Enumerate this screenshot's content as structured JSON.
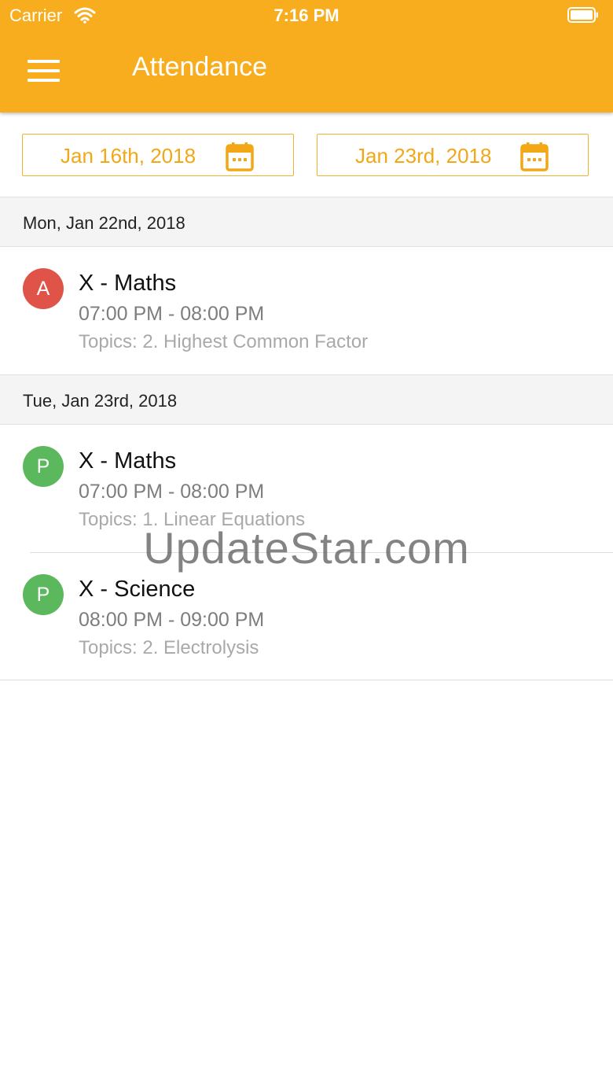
{
  "status_bar": {
    "carrier": "Carrier",
    "time": "7:16 PM"
  },
  "app_bar": {
    "title": "Attendance",
    "menu_icon": "hamburger-menu-icon"
  },
  "date_range": {
    "from": "Jan 16th, 2018",
    "to": "Jan 23rd, 2018",
    "icon": "calendar-icon"
  },
  "sections": [
    {
      "header": "Mon, Jan 22nd, 2018",
      "items": [
        {
          "badge": "A",
          "subject": "X - Maths",
          "time": "07:00 PM - 08:00 PM",
          "topics": "Topics: 2. Highest Common Factor"
        }
      ]
    },
    {
      "header": "Tue, Jan 23rd, 2018",
      "items": [
        {
          "badge": "P",
          "subject": "X - Maths",
          "time": "07:00 PM - 08:00 PM",
          "topics": "Topics: 1. Linear Equations"
        },
        {
          "badge": "P",
          "subject": "X - Science",
          "time": "08:00 PM - 09:00 PM",
          "topics": "Topics: 2. Electrolysis"
        }
      ]
    }
  ],
  "watermark": "UpdateStar.com",
  "colors": {
    "accent": "#f8ad1e",
    "absent": "#e05349",
    "present": "#5cb85c",
    "date_text": "#f2a716"
  }
}
